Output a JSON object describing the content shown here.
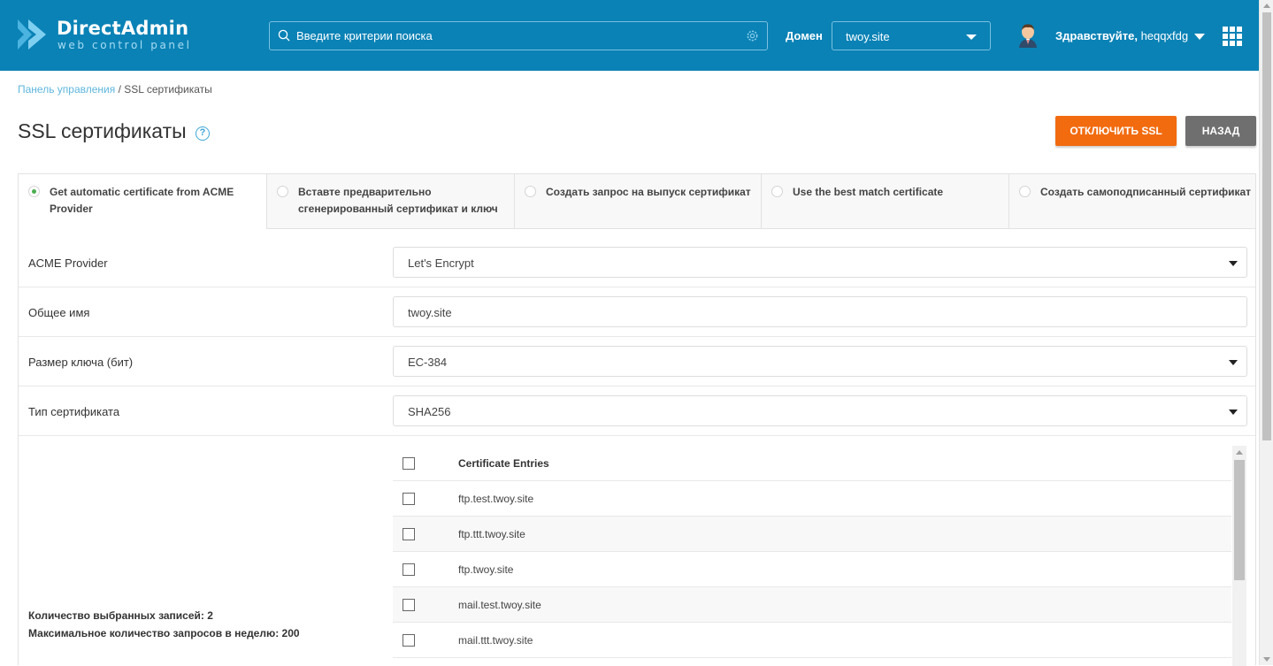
{
  "header": {
    "logo_title": "DirectAdmin",
    "logo_subtitle": "web control panel",
    "search_placeholder": "Введите критерии поиска",
    "domain_label": "Домен",
    "domain_value": "twoy.site",
    "greeting_prefix": "Здравствуйте,",
    "username": "heqqxfdg",
    "accent_color": "#0a82b6"
  },
  "breadcrumb": {
    "home": "Панель управления",
    "separator": " / ",
    "current": "SSL сертификаты"
  },
  "page": {
    "title": "SSL сертификаты",
    "help_glyph": "?",
    "disable_ssl_button": "ОТКЛЮЧИТЬ SSL",
    "back_button": "НАЗАД"
  },
  "tabs": [
    {
      "label": "Get automatic certificate from ACME Provider",
      "selected": true
    },
    {
      "label": "Вставте предварительно сгенерированный сертификат и ключ",
      "selected": false
    },
    {
      "label": "Создать запрос на выпуск сертификат",
      "selected": false
    },
    {
      "label": "Use the best match certificate",
      "selected": false
    },
    {
      "label": "Создать самоподписанный сертификат",
      "selected": false
    }
  ],
  "form": {
    "acme_provider": {
      "label": "ACME Provider",
      "value": "Let's Encrypt"
    },
    "common_name": {
      "label": "Общее имя",
      "value": "twoy.site"
    },
    "key_size": {
      "label": "Размер ключа (бит)",
      "value": "EC-384"
    },
    "cert_type": {
      "label": "Тип сертификата",
      "value": "SHA256"
    }
  },
  "entries": {
    "header": "Certificate Entries",
    "items": [
      "ftp.test.twoy.site",
      "ftp.ttt.twoy.site",
      "ftp.twoy.site",
      "mail.test.twoy.site",
      "mail.ttt.twoy.site"
    ]
  },
  "stats": {
    "selected": "Количество выбранных записей: 2",
    "max_per_week": "Максимальное количество запросов в неделю: 200"
  }
}
